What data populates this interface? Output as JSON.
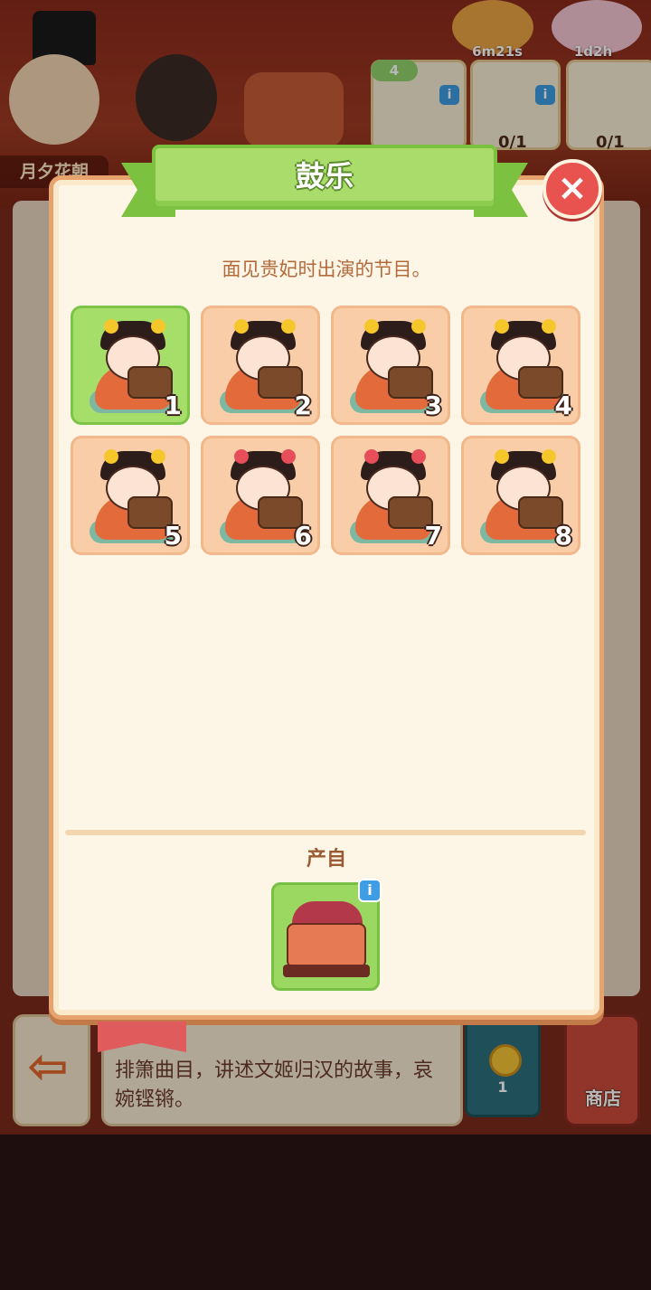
{
  "background": {
    "area_label": "月夕花朝",
    "timers": [
      "6m21s",
      "1d2h"
    ],
    "task_level": "4",
    "task_counts": [
      "0/1",
      "0/1"
    ],
    "description": "排箫曲目，讲述文姬归汉的故事，哀婉铿锵。",
    "coin_count": "1",
    "shop_label": "商店"
  },
  "modal": {
    "title": "鼓乐",
    "close_icon": "×",
    "subtitle": "面见贵妃时出演的节目。",
    "items": [
      {
        "num": "1",
        "active": true,
        "instrument": "panpipe",
        "flower": "#f6c72b"
      },
      {
        "num": "2",
        "active": false,
        "instrument": "bass-lute",
        "flower": "#f6c72b"
      },
      {
        "num": "3",
        "active": false,
        "instrument": "pipa",
        "flower": "#f6c72b"
      },
      {
        "num": "4",
        "active": false,
        "instrument": "erhu",
        "flower": "#f6c72b"
      },
      {
        "num": "5",
        "active": false,
        "instrument": "guzheng",
        "flower": "#f6c72b"
      },
      {
        "num": "6",
        "active": false,
        "instrument": "drum",
        "flower": "#e84e5a"
      },
      {
        "num": "7",
        "active": false,
        "instrument": "harp",
        "flower": "#e84e5a"
      },
      {
        "num": "8",
        "active": false,
        "instrument": "ribbon-hoop",
        "flower": "#f6c72b"
      }
    ],
    "produce_label": "产自",
    "produce_info_icon": "i"
  }
}
